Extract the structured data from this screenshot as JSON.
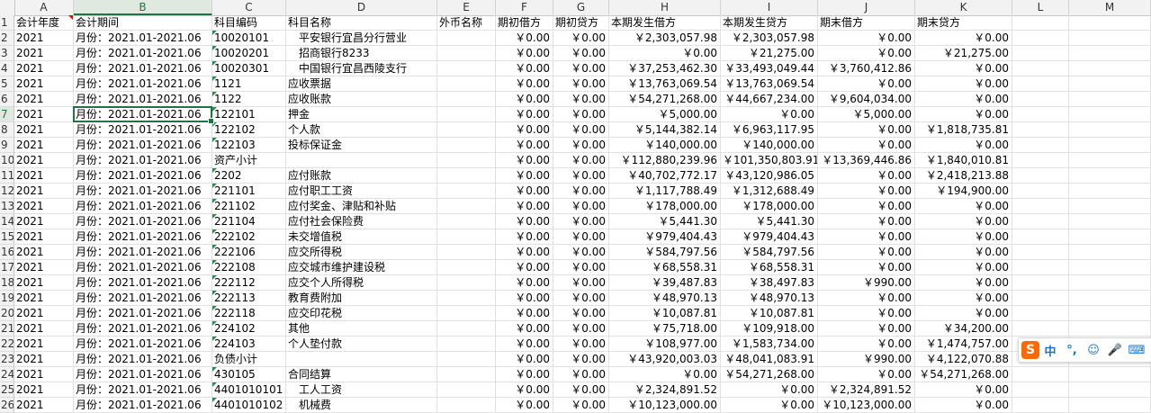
{
  "columns": [
    {
      "letter": "A",
      "header": "会计年度",
      "selected": false
    },
    {
      "letter": "B",
      "header": "会计期间",
      "selected": true
    },
    {
      "letter": "C",
      "header": "科目编码",
      "selected": false
    },
    {
      "letter": "D",
      "header": "科目名称",
      "selected": false
    },
    {
      "letter": "E",
      "header": "外币名称",
      "selected": false
    },
    {
      "letter": "F",
      "header": "期初借方",
      "selected": false
    },
    {
      "letter": "G",
      "header": "期初贷方",
      "selected": false
    },
    {
      "letter": "H",
      "header": "本期发生借方",
      "selected": false
    },
    {
      "letter": "I",
      "header": "本期发生贷方",
      "selected": false
    },
    {
      "letter": "J",
      "header": "期末借方",
      "selected": false
    },
    {
      "letter": "K",
      "header": "期末贷方",
      "selected": false
    },
    {
      "letter": "L",
      "header": "",
      "selected": false
    },
    {
      "letter": "M",
      "header": "",
      "selected": false
    }
  ],
  "active_cell": "B7",
  "rows": [
    {
      "n": "2",
      "a": "2021",
      "b": "月份：2021.01-2021.06",
      "c": "10020101",
      "d": "　平安银行宜昌分行营业",
      "f": "￥0.00",
      "g": "￥0.00",
      "h": "￥2,303,057.98",
      "i": "￥2,303,057.98",
      "j": "￥0.00",
      "k": "￥0.00"
    },
    {
      "n": "3",
      "a": "2021",
      "b": "月份：2021.01-2021.06",
      "c": "10020201",
      "d": "　招商银行8233",
      "f": "￥0.00",
      "g": "￥0.00",
      "h": "￥0.00",
      "i": "￥21,275.00",
      "j": "￥0.00",
      "k": "￥21,275.00"
    },
    {
      "n": "4",
      "a": "2021",
      "b": "月份：2021.01-2021.06",
      "c": "10020301",
      "d": "　中国银行宜昌西陵支行",
      "f": "￥0.00",
      "g": "￥0.00",
      "h": "￥37,253,462.30",
      "i": "￥33,493,049.44",
      "j": "￥3,760,412.86",
      "k": "￥0.00"
    },
    {
      "n": "5",
      "a": "2021",
      "b": "月份：2021.01-2021.06",
      "c": "1121",
      "d": "应收票据",
      "f": "￥0.00",
      "g": "￥0.00",
      "h": "￥13,763,069.54",
      "i": "￥13,763,069.54",
      "j": "￥0.00",
      "k": "￥0.00"
    },
    {
      "n": "6",
      "a": "2021",
      "b": "月份：2021.01-2021.06",
      "c": "1122",
      "d": "应收账款",
      "f": "￥0.00",
      "g": "￥0.00",
      "h": "￥54,271,268.00",
      "i": "￥44,667,234.00",
      "j": "￥9,604,034.00",
      "k": "￥0.00"
    },
    {
      "n": "7",
      "a": "2021",
      "b": "月份：2021.01-2021.06",
      "c": "122101",
      "d": "押金",
      "f": "￥0.00",
      "g": "￥0.00",
      "h": "￥5,000.00",
      "i": "￥0.00",
      "j": "￥5,000.00",
      "k": "￥0.00"
    },
    {
      "n": "8",
      "a": "2021",
      "b": "月份：2021.01-2021.06",
      "c": "122102",
      "d": "个人款",
      "f": "￥0.00",
      "g": "￥0.00",
      "h": "￥5,144,382.14",
      "i": "￥6,963,117.95",
      "j": "￥0.00",
      "k": "￥1,818,735.81"
    },
    {
      "n": "9",
      "a": "2021",
      "b": "月份：2021.01-2021.06",
      "c": "122103",
      "d": "投标保证金",
      "f": "￥0.00",
      "g": "￥0.00",
      "h": "￥140,000.00",
      "i": "￥140,000.00",
      "j": "￥0.00",
      "k": "￥0.00"
    },
    {
      "n": "10",
      "a": "2021",
      "b": "月份：2021.01-2021.06",
      "c": "资产小计",
      "d": "",
      "f": "￥0.00",
      "g": "￥0.00",
      "h": "￥112,880,239.96",
      "i": "￥101,350,803.91",
      "j": "￥13,369,446.86",
      "k": "￥1,840,010.81"
    },
    {
      "n": "11",
      "a": "2021",
      "b": "月份：2021.01-2021.06",
      "c": "2202",
      "d": "应付账款",
      "f": "￥0.00",
      "g": "￥0.00",
      "h": "￥40,702,772.17",
      "i": "￥43,120,986.05",
      "j": "￥0.00",
      "k": "￥2,418,213.88"
    },
    {
      "n": "12",
      "a": "2021",
      "b": "月份：2021.01-2021.06",
      "c": "221101",
      "d": "应付职工工资",
      "f": "￥0.00",
      "g": "￥0.00",
      "h": "￥1,117,788.49",
      "i": "￥1,312,688.49",
      "j": "￥0.00",
      "k": "￥194,900.00"
    },
    {
      "n": "13",
      "a": "2021",
      "b": "月份：2021.01-2021.06",
      "c": "221102",
      "d": "应付奖金、津贴和补贴",
      "f": "￥0.00",
      "g": "￥0.00",
      "h": "￥178,000.00",
      "i": "￥178,000.00",
      "j": "￥0.00",
      "k": "￥0.00"
    },
    {
      "n": "14",
      "a": "2021",
      "b": "月份：2021.01-2021.06",
      "c": "221104",
      "d": "应付社会保险费",
      "f": "￥0.00",
      "g": "￥0.00",
      "h": "￥5,441.30",
      "i": "￥5,441.30",
      "j": "￥0.00",
      "k": "￥0.00"
    },
    {
      "n": "15",
      "a": "2021",
      "b": "月份：2021.01-2021.06",
      "c": "222102",
      "d": "未交增值税",
      "f": "￥0.00",
      "g": "￥0.00",
      "h": "￥979,404.43",
      "i": "￥979,404.43",
      "j": "￥0.00",
      "k": "￥0.00"
    },
    {
      "n": "16",
      "a": "2021",
      "b": "月份：2021.01-2021.06",
      "c": "222106",
      "d": "应交所得税",
      "f": "￥0.00",
      "g": "￥0.00",
      "h": "￥584,797.56",
      "i": "￥584,797.56",
      "j": "￥0.00",
      "k": "￥0.00"
    },
    {
      "n": "17",
      "a": "2021",
      "b": "月份：2021.01-2021.06",
      "c": "222108",
      "d": "应交城市维护建设税",
      "f": "￥0.00",
      "g": "￥0.00",
      "h": "￥68,558.31",
      "i": "￥68,558.31",
      "j": "￥0.00",
      "k": "￥0.00"
    },
    {
      "n": "18",
      "a": "2021",
      "b": "月份：2021.01-2021.06",
      "c": "222112",
      "d": "应交个人所得税",
      "f": "￥0.00",
      "g": "￥0.00",
      "h": "￥39,487.83",
      "i": "￥38,497.83",
      "j": "￥990.00",
      "k": "￥0.00"
    },
    {
      "n": "19",
      "a": "2021",
      "b": "月份：2021.01-2021.06",
      "c": "222113",
      "d": "教育费附加",
      "f": "￥0.00",
      "g": "￥0.00",
      "h": "￥48,970.13",
      "i": "￥48,970.13",
      "j": "￥0.00",
      "k": "￥0.00"
    },
    {
      "n": "20",
      "a": "2021",
      "b": "月份：2021.01-2021.06",
      "c": "222118",
      "d": "应交印花税",
      "f": "￥0.00",
      "g": "￥0.00",
      "h": "￥10,087.81",
      "i": "￥10,087.81",
      "j": "￥0.00",
      "k": "￥0.00"
    },
    {
      "n": "21",
      "a": "2021",
      "b": "月份：2021.01-2021.06",
      "c": "224102",
      "d": "其他",
      "f": "￥0.00",
      "g": "￥0.00",
      "h": "￥75,718.00",
      "i": "￥109,918.00",
      "j": "￥0.00",
      "k": "￥34,200.00"
    },
    {
      "n": "22",
      "a": "2021",
      "b": "月份：2021.01-2021.06",
      "c": "224103",
      "d": "个人垫付款",
      "f": "￥0.00",
      "g": "￥0.00",
      "h": "￥108,977.00",
      "i": "￥1,583,734.00",
      "j": "￥0.00",
      "k": "￥1,474,757.00"
    },
    {
      "n": "23",
      "a": "2021",
      "b": "月份：2021.01-2021.06",
      "c": "负债小计",
      "d": "",
      "f": "￥0.00",
      "g": "￥0.00",
      "h": "￥43,920,003.03",
      "i": "￥48,041,083.91",
      "j": "￥990.00",
      "k": "￥4,122,070.88"
    },
    {
      "n": "24",
      "a": "2021",
      "b": "月份：2021.01-2021.06",
      "c": "430105",
      "d": "合同结算",
      "f": "￥0.00",
      "g": "￥0.00",
      "h": "￥0.00",
      "i": "￥54,271,268.00",
      "j": "￥0.00",
      "k": "￥54,271,268.00"
    },
    {
      "n": "25",
      "a": "2021",
      "b": "月份：2021.01-2021.06",
      "c": "4401010101",
      "d": "　工人工资",
      "f": "￥0.00",
      "g": "￥0.00",
      "h": "￥2,324,891.52",
      "i": "￥0.00",
      "j": "￥2,324,891.52",
      "k": "￥0.00"
    },
    {
      "n": "26",
      "a": "2021",
      "b": "月份：2021.01-2021.06",
      "c": "4401010102",
      "d": "　机械费",
      "f": "￥0.00",
      "g": "￥0.00",
      "h": "￥10,123,000.00",
      "i": "￥0.00",
      "j": "￥10,123,000.00",
      "k": "￥0.00"
    }
  ],
  "header_row_number": "1",
  "ime_toolbar": {
    "logo": "S",
    "items": [
      "中",
      "°,",
      "☺",
      "🎤",
      "⌨"
    ]
  },
  "colors": {
    "accent": "#217346",
    "comment_marker": "#d40000",
    "ime_logo": "#ff6a00"
  }
}
